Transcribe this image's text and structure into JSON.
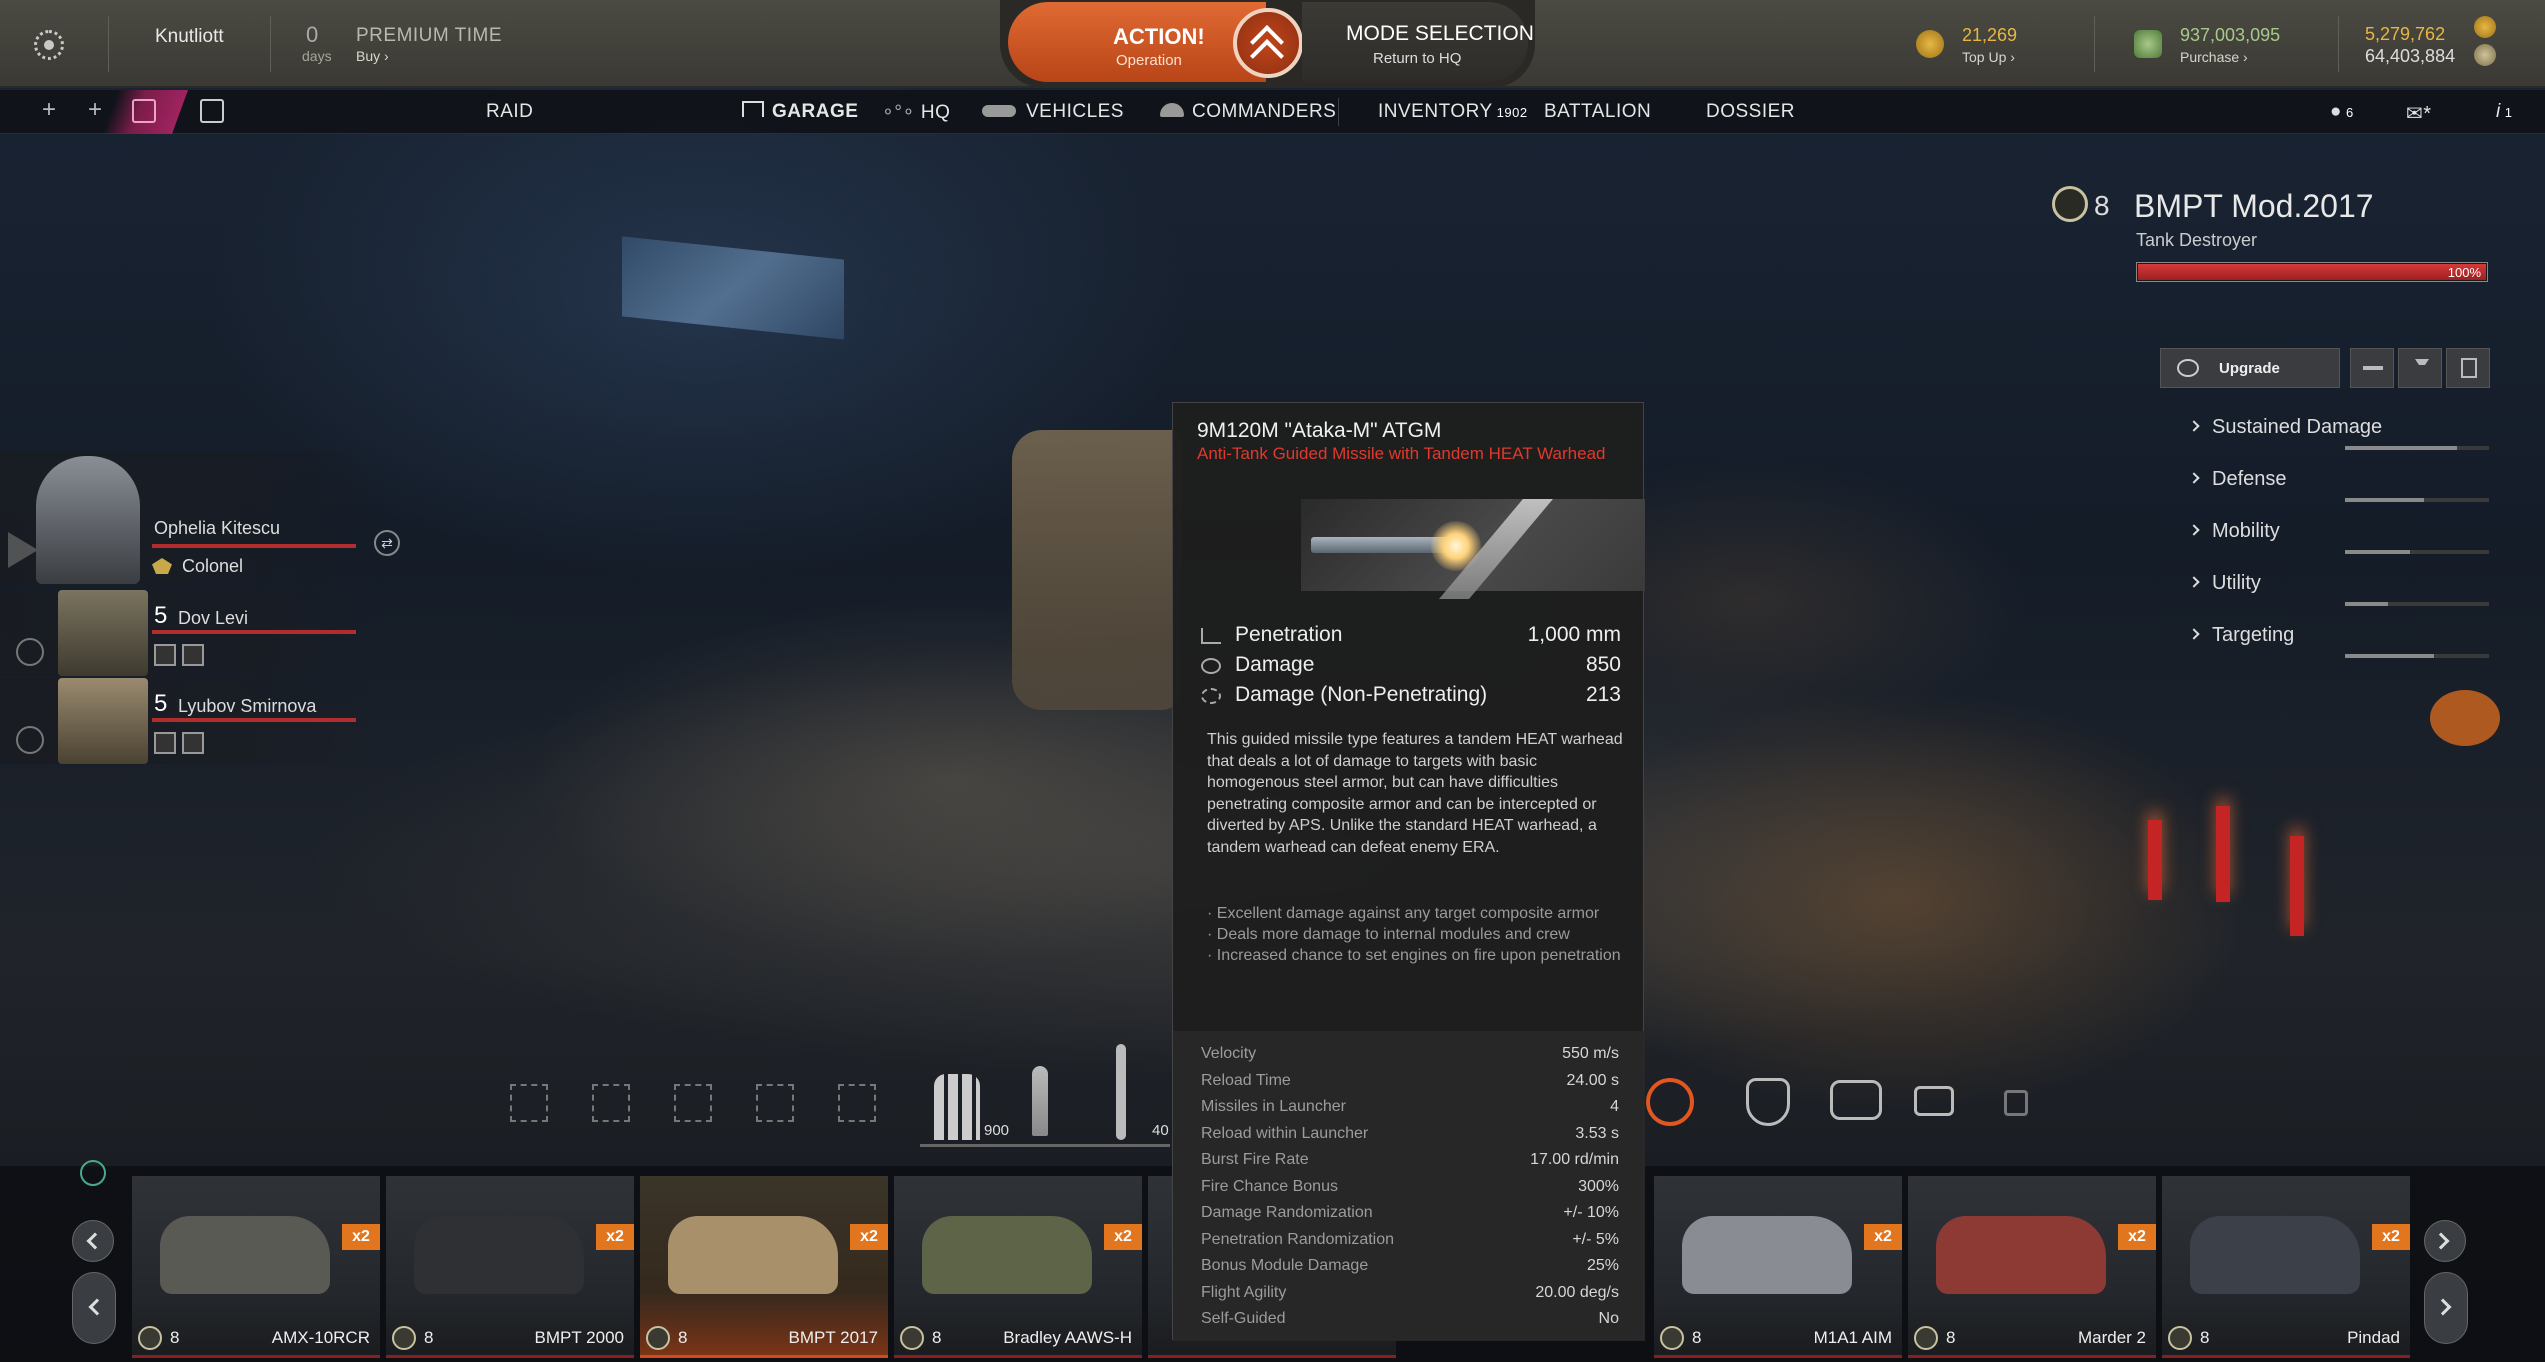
{
  "topbar": {
    "username": "Knutliott",
    "premium_days": "0",
    "premium_days_label": "days",
    "premium_title": "PREMIUM TIME",
    "premium_buy": "Buy",
    "action_title": "ACTION!",
    "action_sub": "Operation",
    "mode_title": "MODE SELECTION",
    "mode_sub": "Return to HQ",
    "gold_value": "21,269",
    "gold_action": "Top Up",
    "credits_value": "937,003,095",
    "credits_action": "Purchase",
    "xp_value": "5,279,762",
    "free_xp_value": "64,403,884"
  },
  "nav": {
    "raid": "RAID",
    "garage": "GARAGE",
    "hq": "HQ",
    "vehicles": "VEHICLES",
    "commanders": "COMMANDERS",
    "inventory": "INVENTORY",
    "inventory_count": "1902",
    "battalion": "BATTALION",
    "dossier": "DOSSIER",
    "friends_count": "6",
    "chat_count": "1"
  },
  "vehicle": {
    "tier": "8",
    "name": "BMPT Mod.2017",
    "class": "Tank Destroyer",
    "hp_percent": "100%",
    "hp_fraction": 1.0,
    "upgrade_label": "Upgrade",
    "stats": [
      {
        "label": "Sustained Damage",
        "fill": 0.78
      },
      {
        "label": "Defense",
        "fill": 0.55
      },
      {
        "label": "Mobility",
        "fill": 0.45
      },
      {
        "label": "Utility",
        "fill": 0.3
      },
      {
        "label": "Targeting",
        "fill": 0.62
      }
    ]
  },
  "crew": [
    {
      "name": "Ophelia Kitescu",
      "rank": "Colonel",
      "level": ""
    },
    {
      "name": "Dov Levi",
      "rank": "",
      "level": "5"
    },
    {
      "name": "Lyubov Smirnova",
      "rank": "",
      "level": "5"
    }
  ],
  "tooltip": {
    "title": "9M120M \"Ataka-M\" ATGM",
    "subtitle": "Anti-Tank Guided Missile with Tandem HEAT Warhead",
    "main_stats": [
      {
        "label": "Penetration",
        "value": "1,000 mm"
      },
      {
        "label": "Damage",
        "value": "850"
      },
      {
        "label": "Damage (Non-Penetrating)",
        "value": "213"
      }
    ],
    "description": "This guided missile type features a tandem HEAT warhead that deals a lot of damage to targets with basic homogenous steel armor, but can have difficulties penetrating composite armor and can be intercepted or diverted by APS. Unlike the standard HEAT warhead, a tandem warhead can defeat enemy ERA.",
    "bullets": [
      "· Excellent damage against any target composite armor",
      "· Deals more damage to internal modules and crew",
      "· Increased chance to set engines on fire upon penetration"
    ],
    "specs": [
      {
        "label": "Velocity",
        "value": "550 m/s"
      },
      {
        "label": "Reload Time",
        "value": "24.00 s"
      },
      {
        "label": "Missiles in Launcher",
        "value": "4"
      },
      {
        "label": "Reload within Launcher",
        "value": "3.53 s"
      },
      {
        "label": "Burst Fire Rate",
        "value": "17.00 rd/min"
      },
      {
        "label": "Fire Chance Bonus",
        "value": "300%"
      },
      {
        "label": "Damage Randomization",
        "value": "+/- 10%"
      },
      {
        "label": "Penetration Randomization",
        "value": "+/- 5%"
      },
      {
        "label": "Bonus Module Damage",
        "value": "25%"
      },
      {
        "label": "Flight Agility",
        "value": "20.00 deg/s"
      },
      {
        "label": "Self-Guided",
        "value": "No"
      }
    ]
  },
  "ammo": {
    "count_1": "900",
    "count_2": "40"
  },
  "carousel": [
    {
      "tier": "8",
      "name": "AMX-10RCR",
      "bonus": "x2",
      "color": "#5a5a55"
    },
    {
      "tier": "8",
      "name": "BMPT 2000",
      "bonus": "x2",
      "color": "#2e3033"
    },
    {
      "tier": "8",
      "name": "BMPT 2017",
      "bonus": "x2",
      "color": "#a8916a",
      "selected": true
    },
    {
      "tier": "8",
      "name": "Bradley AAWS-H",
      "bonus": "x2",
      "color": "#5d6448"
    },
    {
      "tier": "8",
      "name": "M1A1 AIM",
      "bonus": "x2",
      "color": "#8a8c94"
    },
    {
      "tier": "8",
      "name": "Marder 2",
      "bonus": "x2",
      "color": "#8e3a34"
    },
    {
      "tier": "8",
      "name": "Pindad",
      "bonus": "x2",
      "color": "#3c4048"
    }
  ],
  "colors": {
    "accent": "#e06a33",
    "red": "#b22e2e",
    "bonus": "#e2761f"
  }
}
